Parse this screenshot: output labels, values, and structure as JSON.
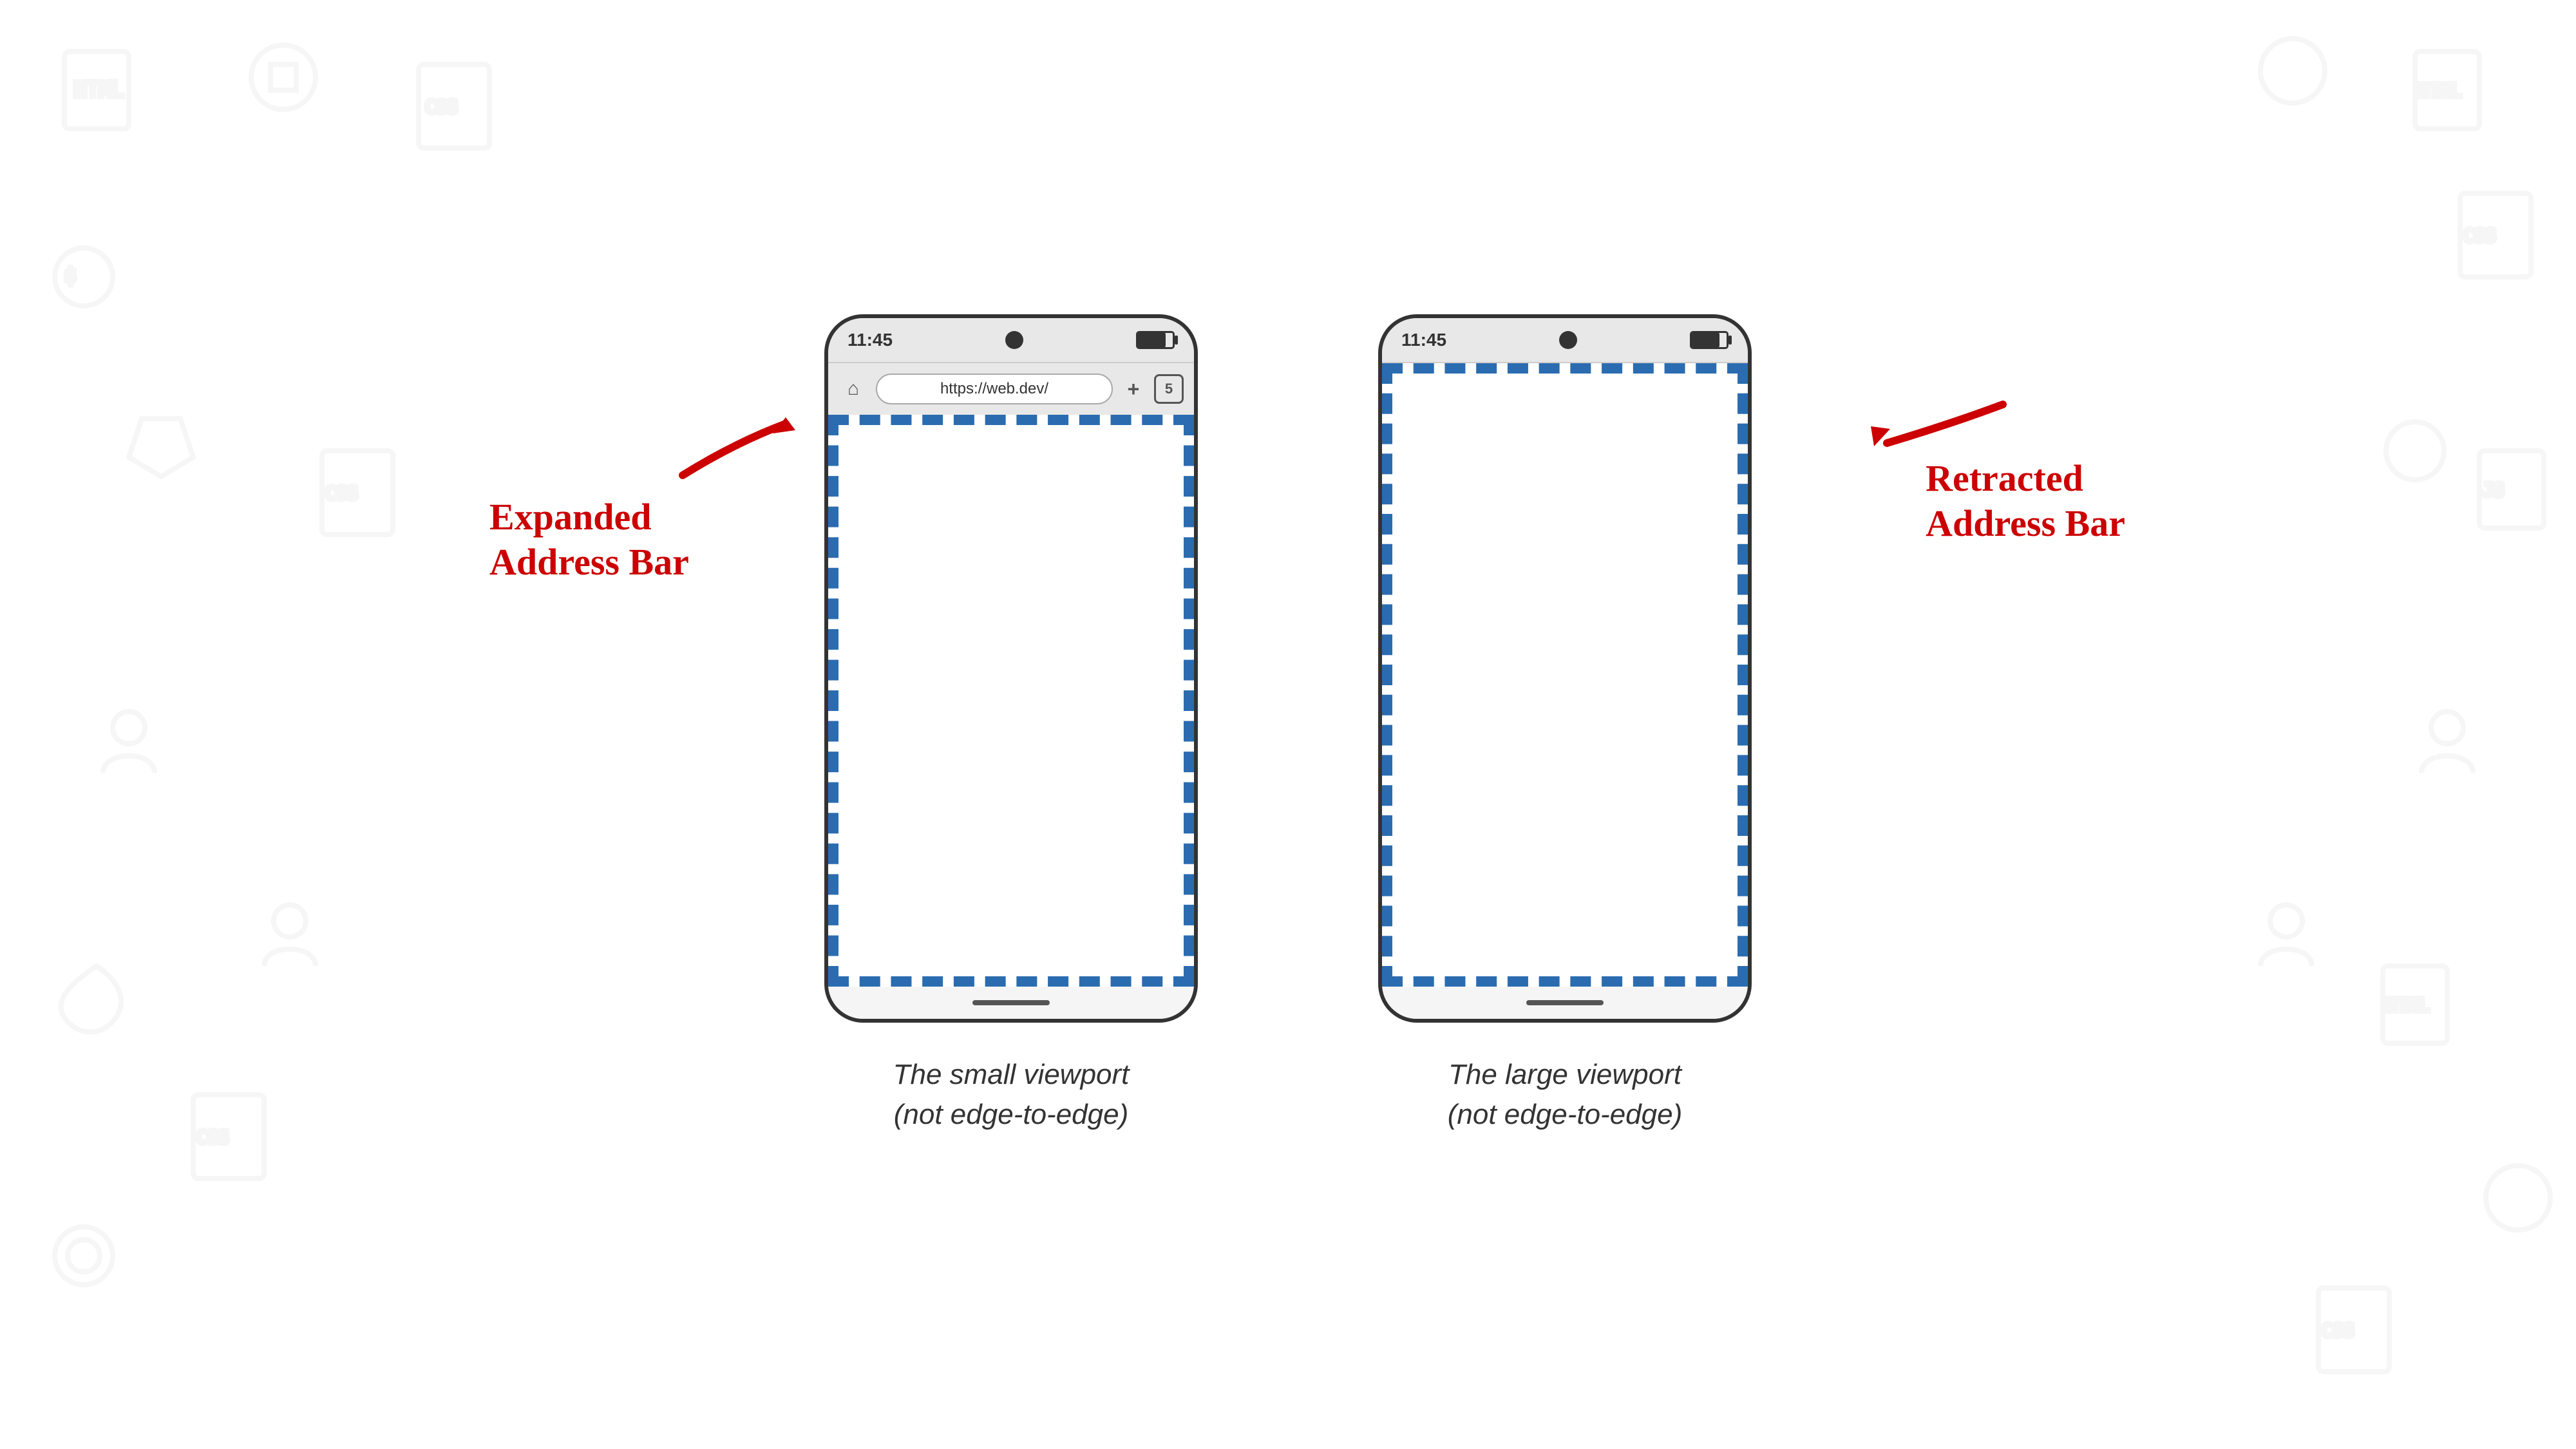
{
  "background": {
    "color": "#ffffff"
  },
  "phone_left": {
    "status_bar": {
      "time": "11:45",
      "has_camera": true,
      "has_battery": true
    },
    "address_bar": {
      "url": "https://web.dev/",
      "tabs_count": "5",
      "has_home": true,
      "has_add": true
    },
    "viewport_label": "The small viewport\n(not edge-to-edge)",
    "annotation_text": "Expanded\nAddress Bar",
    "viewport_border_color": "#2b6cb0"
  },
  "phone_right": {
    "status_bar": {
      "time": "11:45",
      "has_camera": true,
      "has_battery": true
    },
    "viewport_label": "The large viewport\n(not edge-to-edge)",
    "annotation_text": "Retracted\nAddress Bar",
    "viewport_border_color": "#2b6cb0"
  },
  "annotation_color": "#cc0000"
}
